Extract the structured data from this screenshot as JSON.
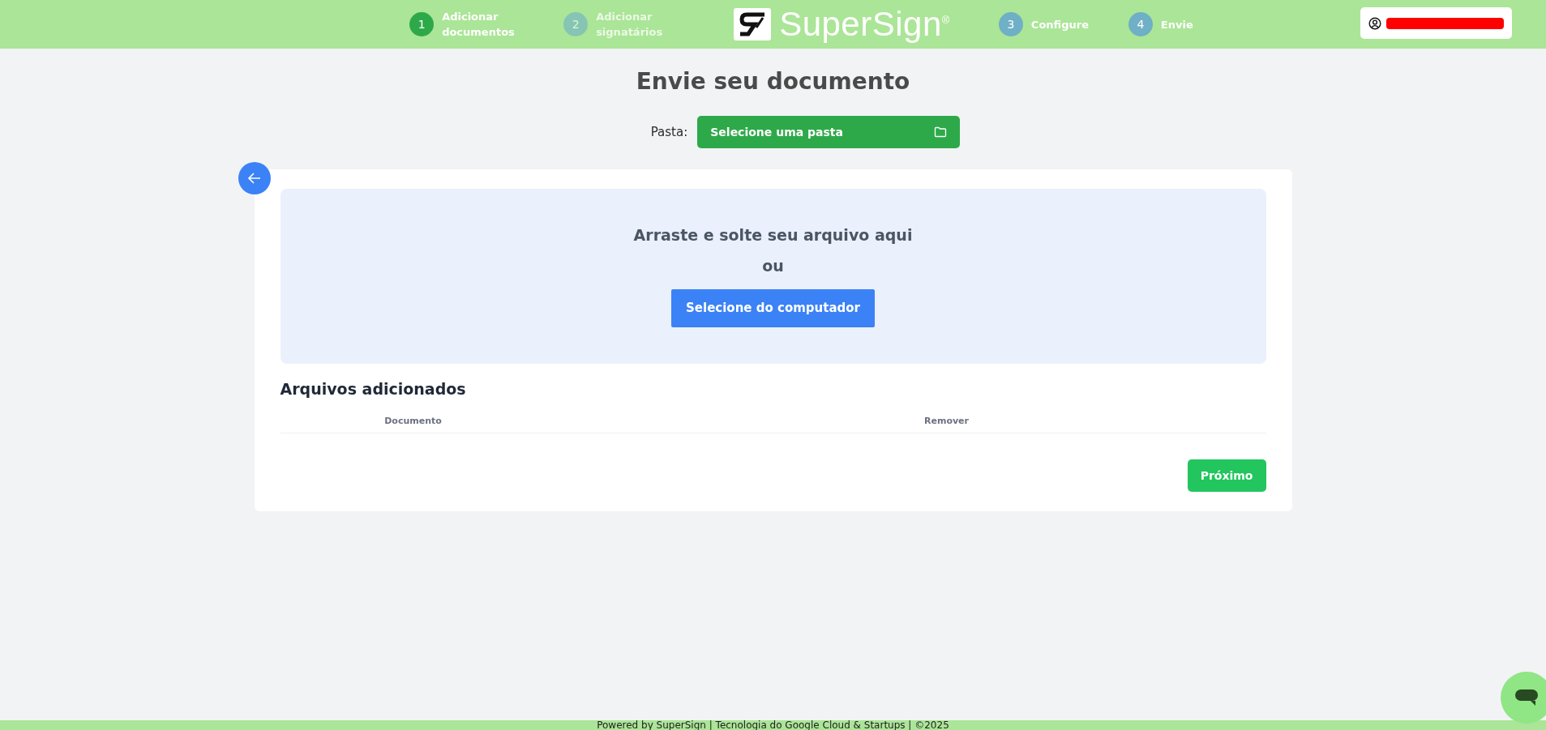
{
  "steps": [
    {
      "number": "1",
      "label": "Adicionar documentos",
      "selected": true,
      "disabled": false
    },
    {
      "number": "2",
      "label": "Adicionar signatários",
      "selected": false,
      "disabled": true
    },
    {
      "number": "3",
      "label": "Configure",
      "selected": false,
      "disabled": false
    },
    {
      "number": "4",
      "label": "Envie",
      "selected": false,
      "disabled": false
    }
  ],
  "logo": {
    "text": "SuperSign",
    "mark": "®"
  },
  "user": {
    "redacted": true
  },
  "title": "Envie seu documento",
  "folder": {
    "label": "Pasta:",
    "button": "Selecione uma pasta"
  },
  "dropzone": {
    "text": "Arraste e solte seu arquivo aqui",
    "or": "ou",
    "button": "Selecione do computador"
  },
  "files": {
    "title": "Arquivos adicionados",
    "columns": [
      "Documento",
      "Remover"
    ]
  },
  "next_button": "Próximo",
  "footer": "Powered by SuperSign | Tecnologia do Google Cloud & Startups | ©2025"
}
